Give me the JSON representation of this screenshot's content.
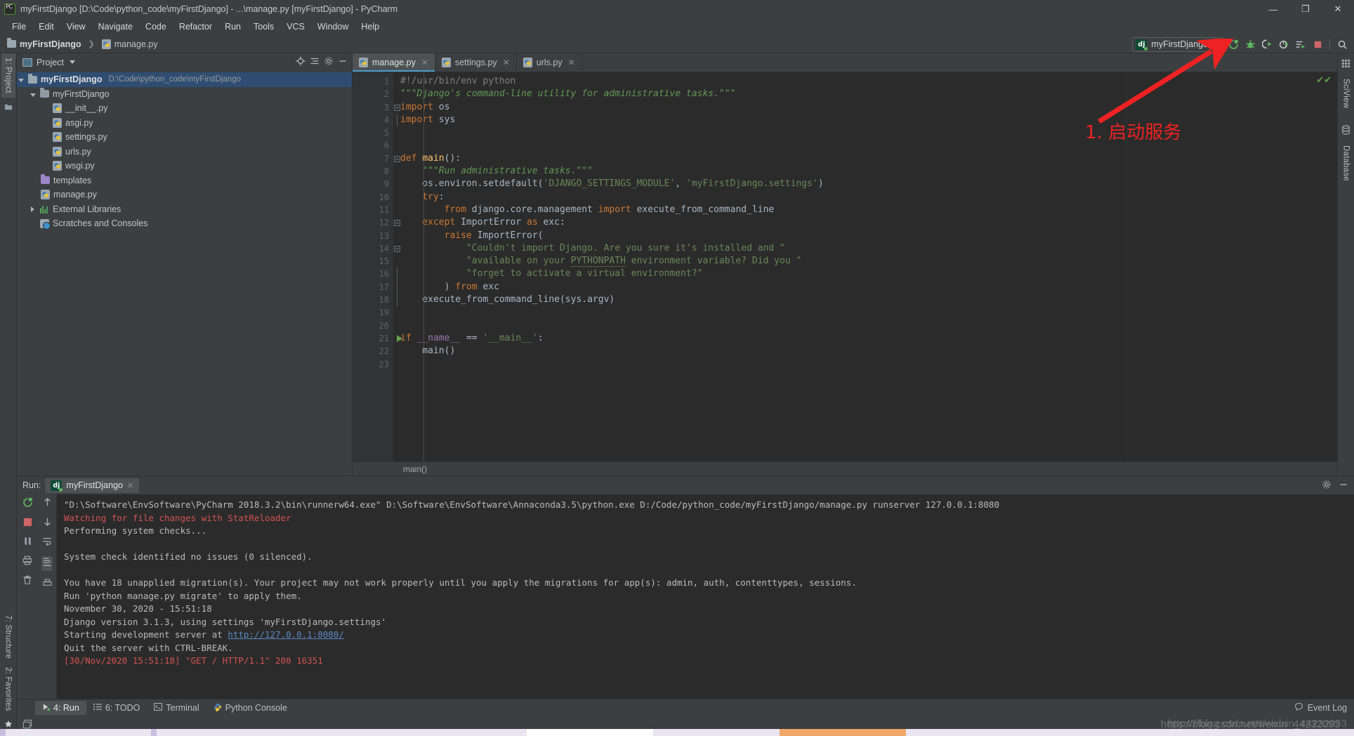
{
  "window": {
    "title": "myFirstDjango [D:\\Code\\python_code\\myFirstDjango] - ...\\manage.py [myFirstDjango] - PyCharm",
    "app_icon": "pycharm-logo-icon",
    "minimize": "—",
    "maximize": "❐",
    "close": "✕"
  },
  "menubar": {
    "items": [
      {
        "label": "File"
      },
      {
        "label": "Edit"
      },
      {
        "label": "View"
      },
      {
        "label": "Navigate"
      },
      {
        "label": "Code"
      },
      {
        "label": "Refactor"
      },
      {
        "label": "Run"
      },
      {
        "label": "Tools"
      },
      {
        "label": "VCS"
      },
      {
        "label": "Window"
      },
      {
        "label": "Help"
      }
    ]
  },
  "navbar": {
    "crumbs": [
      "myFirstDjango",
      "manage.py"
    ],
    "separator": "❯",
    "run_config": {
      "badge": "dj",
      "name": "myFirstDjango",
      "dropdown_caret": "▼"
    },
    "toolbar_icons": [
      "run-icon",
      "debug-icon",
      "run-coverage-icon",
      "profile-icon",
      "run-with-console-icon",
      "stop-icon",
      "search-everywhere-icon"
    ]
  },
  "left_tool_strip": {
    "project_tab": "1: Project",
    "structure_tab": "7: Structure",
    "favorites_tab": "2: Favorites"
  },
  "project_panel": {
    "title": "Project",
    "dropdown_caret": "▼",
    "header_icons": [
      "locate-icon",
      "collapse-all-icon",
      "settings-gear-icon",
      "hide-icon"
    ],
    "tree": [
      {
        "label": "myFirstDjango",
        "path": "D:\\Code\\python_code\\myFirstDjango",
        "indent": 0,
        "icon": "folder-icon",
        "toggle": "down",
        "selected": true,
        "bold": true
      },
      {
        "label": "myFirstDjango",
        "path": "",
        "indent": 1,
        "icon": "source-folder-icon",
        "toggle": "down",
        "selected": false,
        "bold": false
      },
      {
        "label": "__init__.py",
        "path": "",
        "indent": 2,
        "icon": "python-file-icon",
        "toggle": "none",
        "selected": false,
        "bold": false
      },
      {
        "label": "asgi.py",
        "path": "",
        "indent": 2,
        "icon": "python-file-icon",
        "toggle": "none",
        "selected": false,
        "bold": false
      },
      {
        "label": "settings.py",
        "path": "",
        "indent": 2,
        "icon": "python-file-icon",
        "toggle": "none",
        "selected": false,
        "bold": false
      },
      {
        "label": "urls.py",
        "path": "",
        "indent": 2,
        "icon": "python-file-icon",
        "toggle": "none",
        "selected": false,
        "bold": false
      },
      {
        "label": "wsgi.py",
        "path": "",
        "indent": 2,
        "icon": "python-file-icon",
        "toggle": "none",
        "selected": false,
        "bold": false
      },
      {
        "label": "templates",
        "path": "",
        "indent": 1,
        "icon": "templates-folder-icon",
        "toggle": "none",
        "selected": false,
        "bold": false
      },
      {
        "label": "manage.py",
        "path": "",
        "indent": 1,
        "icon": "python-file-icon",
        "toggle": "none",
        "selected": false,
        "bold": false
      },
      {
        "label": "External Libraries",
        "path": "",
        "indent": 0,
        "icon": "libraries-icon",
        "toggle": "right",
        "selected": false,
        "bold": false
      },
      {
        "label": "Scratches and Consoles",
        "path": "",
        "indent": 0,
        "icon": "scratches-icon",
        "toggle": "none",
        "selected": false,
        "bold": false
      }
    ]
  },
  "editor": {
    "tabs": [
      {
        "label": "manage.py",
        "active": true,
        "close": "✕"
      },
      {
        "label": "settings.py",
        "active": false,
        "close": "✕"
      },
      {
        "label": "urls.py",
        "active": false,
        "close": "✕"
      }
    ],
    "breadcrumb_bottom": "main()",
    "inspection_status": "✔✔",
    "line_count": 23,
    "lines": [
      {
        "n": 1,
        "fold": "none",
        "run": false,
        "tokens": [
          {
            "t": "#!/usr/bin/env python",
            "c": "c"
          }
        ]
      },
      {
        "n": 2,
        "fold": "none",
        "run": false,
        "tokens": [
          {
            "t": "\"\"\"Django's command-line utility for administrative tasks.\"\"\"",
            "c": "d"
          }
        ]
      },
      {
        "n": 3,
        "fold": "top",
        "run": false,
        "tokens": [
          {
            "t": "import ",
            "c": "k"
          },
          {
            "t": "os",
            "c": "n"
          }
        ]
      },
      {
        "n": 4,
        "fold": "bot",
        "run": false,
        "tokens": [
          {
            "t": "import ",
            "c": "k"
          },
          {
            "t": "sys",
            "c": "n"
          }
        ]
      },
      {
        "n": 5,
        "fold": "none",
        "run": false,
        "tokens": []
      },
      {
        "n": 6,
        "fold": "none",
        "run": false,
        "tokens": []
      },
      {
        "n": 7,
        "fold": "top",
        "run": false,
        "tokens": [
          {
            "t": "def ",
            "c": "k"
          },
          {
            "t": "main",
            "c": "f"
          },
          {
            "t": "():",
            "c": "n"
          }
        ]
      },
      {
        "n": 8,
        "fold": "none",
        "run": false,
        "tokens": [
          {
            "t": "    \"\"\"Run administrative tasks.\"\"\"",
            "c": "d"
          }
        ]
      },
      {
        "n": 9,
        "fold": "none",
        "run": false,
        "tokens": [
          {
            "t": "    os.environ.setdefault(",
            "c": "n"
          },
          {
            "t": "'DJANGO_SETTINGS_MODULE'",
            "c": "s"
          },
          {
            "t": ", ",
            "c": "n"
          },
          {
            "t": "'myFirstDjango.settings'",
            "c": "s"
          },
          {
            "t": ")",
            "c": "n"
          }
        ]
      },
      {
        "n": 10,
        "fold": "none",
        "run": false,
        "tokens": [
          {
            "t": "    try",
            "c": "k"
          },
          {
            "t": ":",
            "c": "n"
          }
        ]
      },
      {
        "n": 11,
        "fold": "none",
        "run": false,
        "tokens": [
          {
            "t": "        ",
            "c": "n"
          },
          {
            "t": "from ",
            "c": "k"
          },
          {
            "t": "django.core.management ",
            "c": "n"
          },
          {
            "t": "import ",
            "c": "k"
          },
          {
            "t": "execute_from_command_line",
            "c": "n"
          }
        ]
      },
      {
        "n": 12,
        "fold": "top",
        "run": false,
        "tokens": [
          {
            "t": "    except ",
            "c": "k"
          },
          {
            "t": "ImportError ",
            "c": "n"
          },
          {
            "t": "as ",
            "c": "k"
          },
          {
            "t": "exc:",
            "c": "n"
          }
        ]
      },
      {
        "n": 13,
        "fold": "none",
        "run": false,
        "tokens": [
          {
            "t": "        ",
            "c": "n"
          },
          {
            "t": "raise ",
            "c": "k"
          },
          {
            "t": "ImportError(",
            "c": "n"
          }
        ]
      },
      {
        "n": 14,
        "fold": "top",
        "run": false,
        "tokens": [
          {
            "t": "            \"Couldn't import Django. Are you sure it's installed and \"",
            "c": "s"
          }
        ]
      },
      {
        "n": 15,
        "fold": "none",
        "run": false,
        "tokens": [
          {
            "t": "            \"available on your ",
            "c": "s"
          },
          {
            "t": "PYTHONPATH",
            "c": "s underw"
          },
          {
            "t": " environment variable? Did you \"",
            "c": "s"
          }
        ]
      },
      {
        "n": 16,
        "fold": "bot",
        "run": false,
        "tokens": [
          {
            "t": "            \"forget to activate a virtual environment?\"",
            "c": "s"
          }
        ]
      },
      {
        "n": 17,
        "fold": "bot",
        "run": false,
        "tokens": [
          {
            "t": "        ) ",
            "c": "n"
          },
          {
            "t": "from ",
            "c": "k"
          },
          {
            "t": "exc",
            "c": "n"
          }
        ]
      },
      {
        "n": 18,
        "fold": "bot",
        "run": false,
        "tokens": [
          {
            "t": "    execute_from_command_line(sys.argv)",
            "c": "n"
          }
        ]
      },
      {
        "n": 19,
        "fold": "none",
        "run": false,
        "tokens": []
      },
      {
        "n": 20,
        "fold": "none",
        "run": false,
        "tokens": []
      },
      {
        "n": 21,
        "fold": "none",
        "run": true,
        "tokens": [
          {
            "t": "if ",
            "c": "k"
          },
          {
            "t": "__name__ ",
            "c": "kw2"
          },
          {
            "t": "== ",
            "c": "n"
          },
          {
            "t": "'__main__'",
            "c": "s"
          },
          {
            "t": ":",
            "c": "n"
          }
        ]
      },
      {
        "n": 22,
        "fold": "none",
        "run": false,
        "tokens": [
          {
            "t": "    main()",
            "c": "n"
          }
        ]
      },
      {
        "n": 23,
        "fold": "none",
        "run": false,
        "tokens": []
      }
    ]
  },
  "right_tool_strip": {
    "sciview_tab": "SciView",
    "database_tab": "Database"
  },
  "run_panel": {
    "label": "Run:",
    "tab": {
      "badge": "dj",
      "name": "myFirstDjango",
      "close": "✕"
    },
    "header_icons": [
      "settings-gear-icon",
      "hide-icon"
    ],
    "tool_icons_left": [
      "rerun-icon",
      "stop-icon",
      "pause-icon",
      "print-icon",
      "delete-icon"
    ],
    "tool_icons_right": [
      "up-icon",
      "down-icon",
      "soft-wrap-icon",
      "scroll-to-end-icon"
    ],
    "console_lines": [
      {
        "text": "\"D:\\Software\\EnvSoftware\\PyCharm 2018.3.2\\bin\\runnerw64.exe\" D:\\Software\\EnvSoftware\\Annaconda3.5\\python.exe D:/Code/python_code/myFirstDjango/manage.py runserver 127.0.0.1:8080",
        "style": "normal"
      },
      {
        "text": "Watching for file changes with StatReloader",
        "style": "red"
      },
      {
        "text": "Performing system checks...",
        "style": "normal"
      },
      {
        "text": "",
        "style": "normal"
      },
      {
        "text": "System check identified no issues (0 silenced).",
        "style": "normal"
      },
      {
        "text": "",
        "style": "normal"
      },
      {
        "text": "You have 18 unapplied migration(s). Your project may not work properly until you apply the migrations for app(s): admin, auth, contenttypes, sessions.",
        "style": "normal"
      },
      {
        "text": "Run 'python manage.py migrate' to apply them.",
        "style": "normal"
      },
      {
        "text": "November 30, 2020 - 15:51:18",
        "style": "normal"
      },
      {
        "text": "Django version 3.1.3, using settings 'myFirstDjango.settings'",
        "style": "normal"
      },
      {
        "text": "Starting development server at ",
        "style": "normal",
        "link": "http://127.0.0.1:8080/"
      },
      {
        "text": "Quit the server with CTRL-BREAK.",
        "style": "normal"
      },
      {
        "text": "[30/Nov/2020 15:51:18] \"GET / HTTP/1.1\" 200 16351",
        "style": "red"
      }
    ]
  },
  "statusbar": {
    "items": [
      {
        "label": "4: Run",
        "icon": "run-icon",
        "active": true
      },
      {
        "label": "6: TODO",
        "icon": "todo-icon",
        "active": false
      },
      {
        "label": "Terminal",
        "icon": "terminal-icon",
        "active": false
      },
      {
        "label": "Python Console",
        "icon": "python-console-icon",
        "active": false
      }
    ],
    "event_log": "Event Log",
    "event_log_icon": "balloon-icon"
  },
  "annotation": {
    "text": "1. 启动服务",
    "arrow": "red-arrow-icon",
    "color": "#ee2222"
  },
  "watermark": {
    "line1": "https://blog.csdn.net/weixin_44232093",
    "line2": "https://blog.csdn.net/weixin_44232093"
  },
  "colors": {
    "chrome": "#3c3f41",
    "editor_bg": "#2b2b2b",
    "gutter_bg": "#313335",
    "selection": "#2f4d72",
    "accent_blue": "#4f9ecb",
    "keyword_orange": "#cc7832",
    "string_green": "#6a8759",
    "docstring_green": "#629755",
    "function_yellow": "#ffc66d",
    "error_red": "#d25252",
    "annotation_red": "#ee2222"
  }
}
